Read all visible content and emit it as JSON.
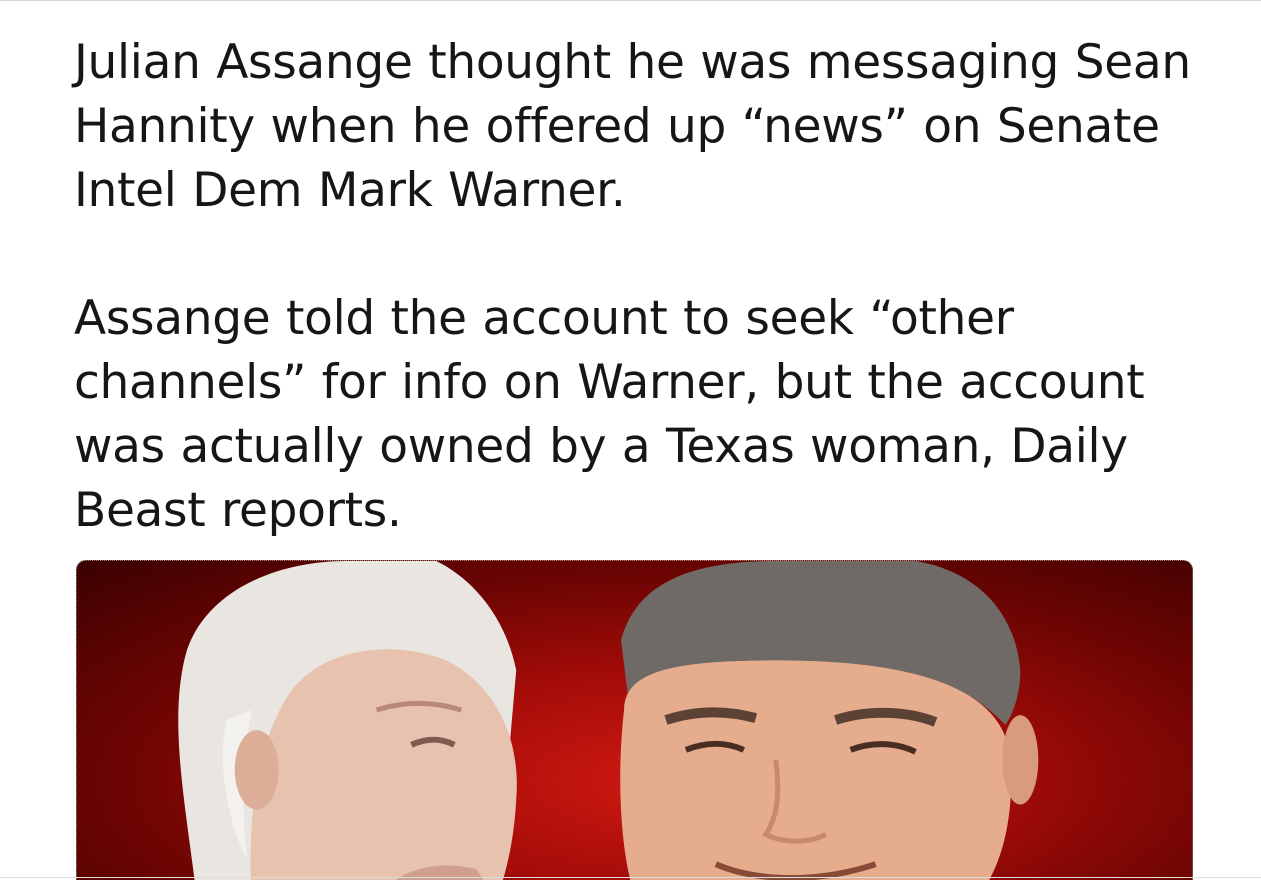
{
  "tweet": {
    "paragraphs": [
      "Julian Assange thought he was messaging Sean Hannity when he offered up “news” on Senate Intel Dem Mark Warner.",
      "Assange told the account to seek “other channels” for info on Warner, but the account was actually owned by a Texas woman, Daily Beast reports."
    ]
  },
  "media": {
    "background_color": "#b30f0a",
    "accent_dark": "#3a0101"
  }
}
